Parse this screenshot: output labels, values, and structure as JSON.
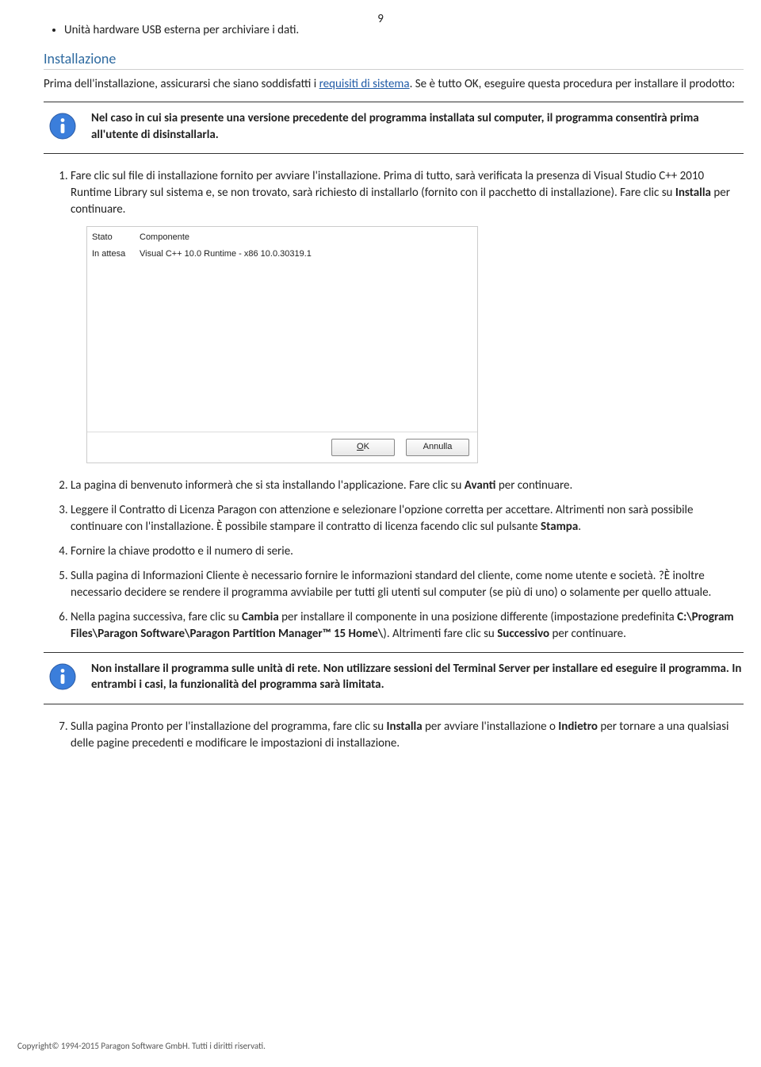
{
  "page_number": "9",
  "bullet_items": [
    "Unità hardware USB esterna per archiviare i dati."
  ],
  "section_title": "Installazione",
  "intro_paragraph_pre": "Prima dell'installazione, assicurarsi che siano soddisfatti i ",
  "intro_paragraph_link": "requisiti di sistema",
  "intro_paragraph_post": ". Se è tutto OK, eseguire questa procedura per installare il prodotto:",
  "note1_text": "Nel caso in cui sia presente una versione precedente del programma installata sul computer, il programma consentirà prima all'utente di disinstallarla.",
  "steps": {
    "s1_pre": "Fare clic sul file di installazione fornito per avviare l'installazione. Prima di tutto, sarà verificata la presenza di Visual Studio C++ 2010 Runtime Library sul sistema e, se non trovato, sarà richiesto di installarlo (fornito con il pacchetto di installazione). Fare clic su ",
    "s1_b1": "Installa",
    "s1_post": " per continuare.",
    "s2_pre": "La pagina di benvenuto informerà che si sta installando l'applicazione. Fare clic su ",
    "s2_b1": "Avanti",
    "s2_post": " per continuare.",
    "s3_pre": "Leggere il Contratto di Licenza Paragon con attenzione e selezionare l'opzione corretta per accettare. Altrimenti non sarà possibile continuare con l'installazione. È possibile stampare il contratto di licenza facendo clic sul pulsante ",
    "s3_b1": "Stampa",
    "s3_post": ".",
    "s4": "Fornire la chiave prodotto e il numero di serie.",
    "s5": "Sulla pagina di Informazioni Cliente è necessario fornire le informazioni standard del cliente, come nome utente e società. ?È inoltre necessario decidere se rendere il programma avviabile per tutti gli utenti sul computer (se più di uno) o solamente per quello attuale.",
    "s6_pre": "Nella pagina successiva, fare clic su ",
    "s6_b1": "Cambia",
    "s6_mid1": " per installare il componente in una posizione differente (impostazione predefinita ",
    "s6_path": "C:\\Program Files\\Paragon Software\\Paragon Partition Manager™ 15 Home\\",
    "s6_mid2": "). Altrimenti fare clic su ",
    "s6_b2": "Successivo",
    "s6_post": " per continuare.",
    "s7_pre": "Sulla pagina Pronto per l'installazione del programma, fare clic su ",
    "s7_b1": "Installa",
    "s7_mid": " per avviare l'installazione o ",
    "s7_b2": "Indietro",
    "s7_post": " per tornare a una qualsiasi delle pagine precedenti e modificare le impostazioni di installazione."
  },
  "note2_text": "Non installare il programma sulle unità di rete. Non utilizzare sessioni del Terminal Server per installare ed eseguire il programma. In entrambi i casi, la funzionalità del programma sarà limitata.",
  "screenshot": {
    "col1": "Stato",
    "col2": "Componente",
    "row1_c1": "In attesa",
    "row1_c2": "Visual C++ 10.0 Runtime - x86 10.0.30319.1",
    "btn_ok_u": "O",
    "btn_ok_rest": "K",
    "btn_cancel": "Annulla"
  },
  "footer": "Copyright© 1994-2015 Paragon Software GmbH. Tutti i diritti riservati."
}
